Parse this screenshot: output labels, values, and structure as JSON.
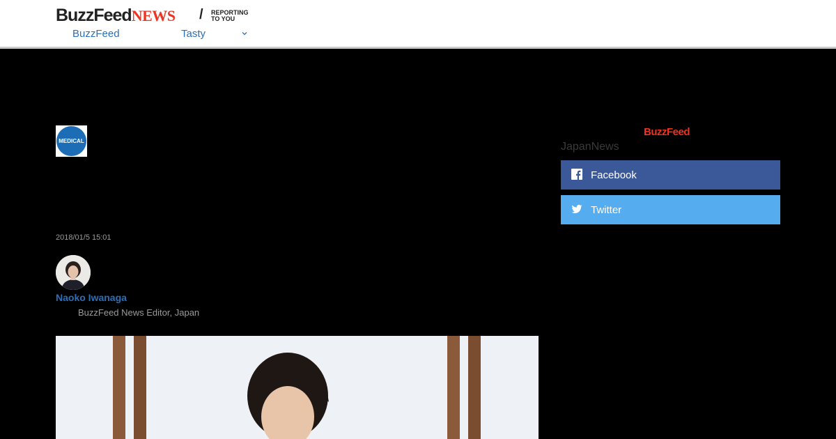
{
  "header": {
    "logo_buzzfeed": "BuzzFeed",
    "logo_news": "NEWS",
    "tagline_line1": "REPORTING",
    "tagline_line2": "TO YOU",
    "nav": [
      {
        "label": "BuzzFeed"
      },
      {
        "label": "Tasty"
      }
    ]
  },
  "article": {
    "category_badge": "MEDICAL",
    "date": "2018/01/5 15:01",
    "author_name": "Naoko Iwanaga",
    "author_role": "BuzzFeed News Editor, Japan"
  },
  "sidebar": {
    "logo": "BuzzFeed",
    "subtitle": "JapanNews",
    "share": [
      {
        "label": "Facebook",
        "icon": "facebook-icon",
        "color": "#3b5998"
      },
      {
        "label": "Twitter",
        "icon": "twitter-icon",
        "color": "#55acee"
      }
    ]
  },
  "colors": {
    "brand_red": "#e32",
    "link_blue": "#2c6fb7",
    "badge_blue": "#1c6db5"
  }
}
